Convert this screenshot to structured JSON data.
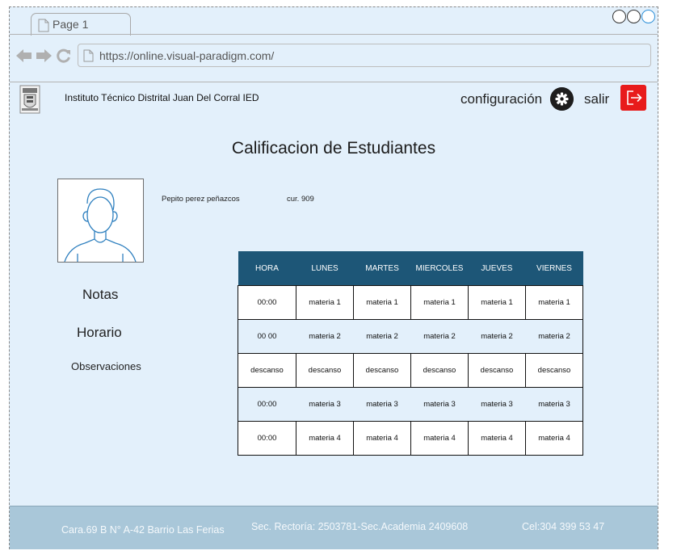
{
  "browser": {
    "tab_label": "Page 1",
    "url": "https://online.visual-paradigm.com/"
  },
  "header": {
    "school_name": "Instituto Técnico Distrital Juan Del Corral IED",
    "config_label": "configuración",
    "logout_label": "salir"
  },
  "page": {
    "title": "Calificacion de Estudiantes"
  },
  "student": {
    "name": "Pepito perez peñazcos",
    "course": "cur. 909"
  },
  "menu": {
    "notas": "Notas",
    "horario": "Horario",
    "observaciones": "Observaciones"
  },
  "schedule": {
    "headers": [
      "HORA",
      "LUNES",
      "MARTES",
      "MIERCOLES",
      "JUEVES",
      "VIERNES"
    ],
    "rows": [
      [
        "00:00",
        "materia 1",
        "materia 1",
        "materia 1",
        "materia 1",
        "materia 1"
      ],
      [
        "00 00",
        "materia 2",
        "materia 2",
        "materia 2",
        "materia 2",
        "materia 2"
      ],
      [
        "descanso",
        "descanso",
        "descanso",
        "descanso",
        "descanso",
        "descanso"
      ],
      [
        "00:00",
        "materia 3",
        "materia 3",
        "materia 3",
        "materia 3",
        "materia 3"
      ],
      [
        "00:00",
        "materia 4",
        "materia 4",
        "materia 4",
        "materia 4",
        "materia 4"
      ]
    ]
  },
  "footer": {
    "address": "Cara.69 B N° A-42 Barrio Las Ferias",
    "phones": "Sec. Rectoría: 2503781-Sec.Academia 2409608",
    "cell": "Cel:304 399 53 47"
  },
  "colors": {
    "background": "#e3f0fb",
    "table_header": "#1d5677",
    "logout_button": "#e81b1b",
    "footer": "#a9c7d9"
  },
  "icons": [
    "page-icon",
    "back-arrow-icon",
    "forward-arrow-icon",
    "reload-icon",
    "gear-icon",
    "logout-icon",
    "user-avatar-icon",
    "school-logo"
  ]
}
